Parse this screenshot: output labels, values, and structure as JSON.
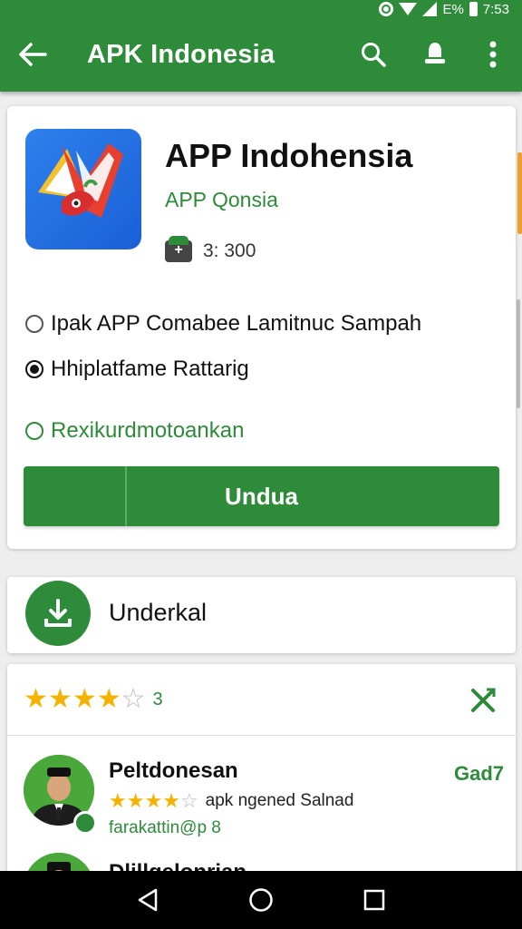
{
  "status_bar": {
    "battery_text": "E%",
    "time": "7:53"
  },
  "app_bar": {
    "title": "APK Indonesia"
  },
  "app": {
    "name": "APP Indohensia",
    "developer": "APP Qonsia",
    "meta_text": "3:  300"
  },
  "options": [
    {
      "label": "Ipak APP Comabee Lamitnuc Sampah",
      "state": "unchecked"
    },
    {
      "label": "Hhiplatfame Rattarig",
      "state": "checked"
    },
    {
      "label": "Rexikurdmotoankan",
      "state": "unchecked"
    }
  ],
  "install_button": {
    "label": "Undua"
  },
  "download_row": {
    "label": "Underkal"
  },
  "rating": {
    "stars": 4,
    "max": 5,
    "count": "3"
  },
  "reviews": [
    {
      "name": "Peltdonesan",
      "tag": "Gad7",
      "stars": 4,
      "text": "apk ngened Salnad",
      "handle": "farakattin@p 8"
    },
    {
      "name": "Dlillgelonrian"
    }
  ],
  "colors": {
    "brand_green": "#2e8b3a",
    "star_gold": "#f5b301"
  },
  "icons": {
    "app_bar": [
      "back-arrow-icon",
      "search-icon",
      "notification-icon",
      "more-vert-icon"
    ],
    "nav": [
      "nav-back-icon",
      "nav-home-icon",
      "nav-recents-icon"
    ]
  }
}
